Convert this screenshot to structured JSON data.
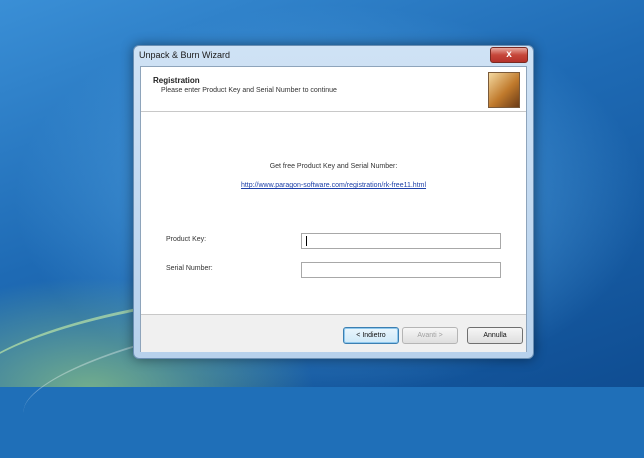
{
  "window": {
    "title": "Unpack & Burn Wizard",
    "close_glyph": "x"
  },
  "header": {
    "title": "Registration",
    "subtitle": "Please enter Product Key and Serial Number to continue",
    "icon": "wizard-banner-icon"
  },
  "body": {
    "free_label": "Get free Product Key and Serial Number:",
    "link": "http://www.paragon-software.com/registration/rk-free11.html",
    "product_key_label": "Product Key:",
    "product_key_value": "",
    "serial_label": "Serial Number:",
    "serial_value": ""
  },
  "buttons": {
    "back": "< Indietro",
    "next": "Avanti >",
    "cancel": "Annulla"
  }
}
